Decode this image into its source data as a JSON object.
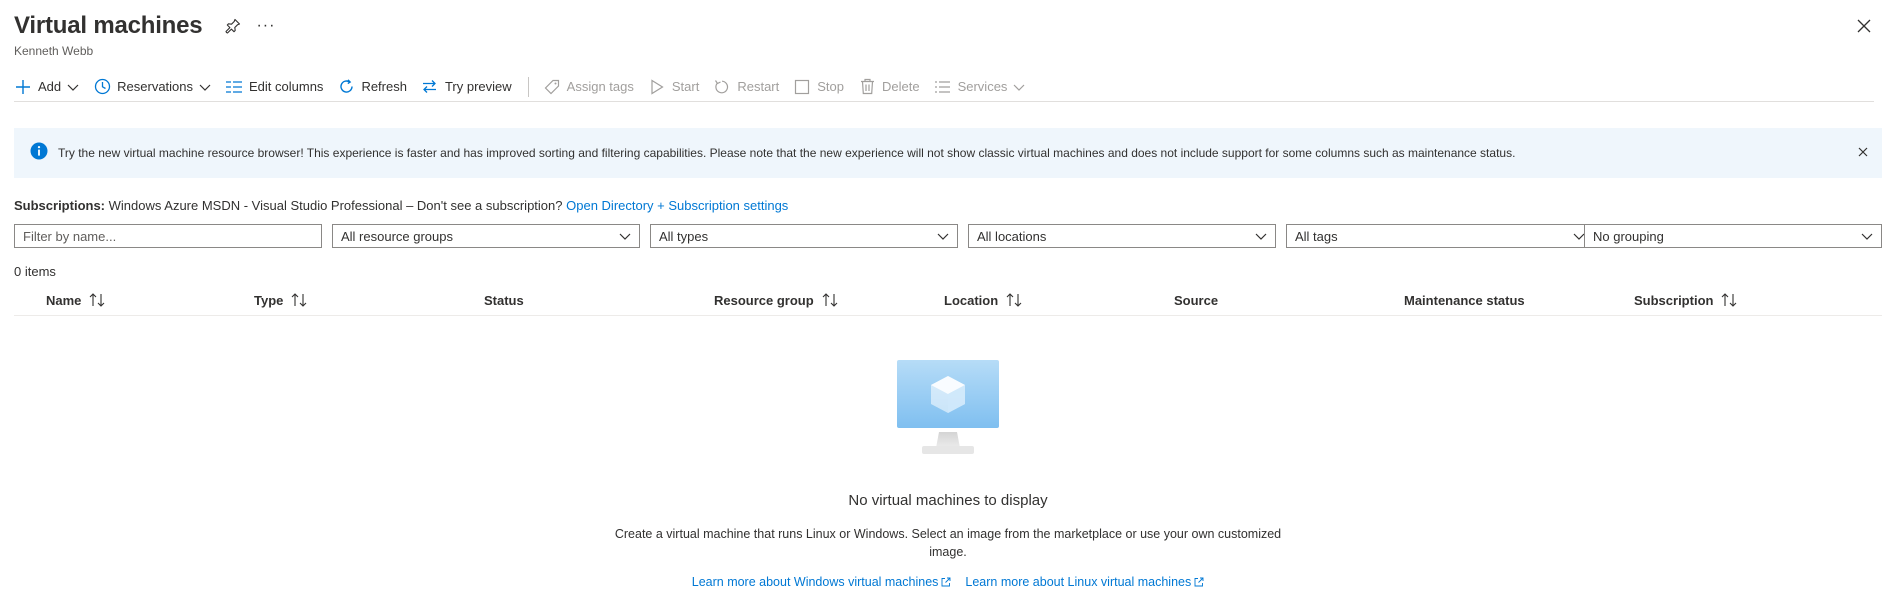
{
  "header": {
    "title": "Virtual machines",
    "subtitle": "Kenneth Webb",
    "more_label": "···"
  },
  "toolbar": {
    "items": [
      {
        "label": "Add",
        "icon": "plus-icon",
        "chevron": true,
        "enabled": true
      },
      {
        "label": "Reservations",
        "icon": "clock-icon",
        "chevron": true,
        "enabled": true
      },
      {
        "label": "Edit columns",
        "icon": "columns-icon",
        "chevron": false,
        "enabled": true
      },
      {
        "label": "Refresh",
        "icon": "refresh-icon",
        "chevron": false,
        "enabled": true
      },
      {
        "label": "Try preview",
        "icon": "swap-icon",
        "chevron": false,
        "enabled": true
      },
      {
        "label": "Assign tags",
        "icon": "tag-icon",
        "chevron": false,
        "enabled": false
      },
      {
        "label": "Start",
        "icon": "play-icon",
        "chevron": false,
        "enabled": false
      },
      {
        "label": "Restart",
        "icon": "restart-icon",
        "chevron": false,
        "enabled": false
      },
      {
        "label": "Stop",
        "icon": "stop-icon",
        "chevron": false,
        "enabled": false
      },
      {
        "label": "Delete",
        "icon": "trash-icon",
        "chevron": false,
        "enabled": false
      },
      {
        "label": "Services",
        "icon": "list-icon",
        "chevron": true,
        "enabled": false
      }
    ]
  },
  "banner": {
    "text": "Try the new virtual machine resource browser! This experience is faster and has improved sorting and filtering capabilities. Please note that the new experience will not show classic virtual machines and does not include support for some columns such as maintenance status."
  },
  "subscriptions": {
    "label": "Subscriptions:",
    "value": "Windows Azure MSDN - Visual Studio Professional – Don't see a subscription?",
    "link": "Open Directory + Subscription settings"
  },
  "filters": {
    "name_placeholder": "Filter by name...",
    "resource_groups": "All resource groups",
    "types": "All types",
    "locations": "All locations",
    "tags": "All tags",
    "grouping": "No grouping"
  },
  "count": "0 items",
  "table": {
    "columns": [
      {
        "label": "Name",
        "sortable": true
      },
      {
        "label": "Type",
        "sortable": true
      },
      {
        "label": "Status",
        "sortable": false
      },
      {
        "label": "Resource group",
        "sortable": true
      },
      {
        "label": "Location",
        "sortable": true
      },
      {
        "label": "Source",
        "sortable": false
      },
      {
        "label": "Maintenance status",
        "sortable": false
      },
      {
        "label": "Subscription",
        "sortable": true
      }
    ]
  },
  "empty_state": {
    "title": "No virtual machines to display",
    "description": "Create a virtual machine that runs Linux or Windows. Select an image from the marketplace or use your own customized image.",
    "link_windows": "Learn more about Windows virtual machines",
    "link_linux": "Learn more about Linux virtual machines"
  },
  "colors": {
    "accent": "#0078d4",
    "banner_bg": "#eff6fc",
    "disabled": "#a19f9d"
  }
}
